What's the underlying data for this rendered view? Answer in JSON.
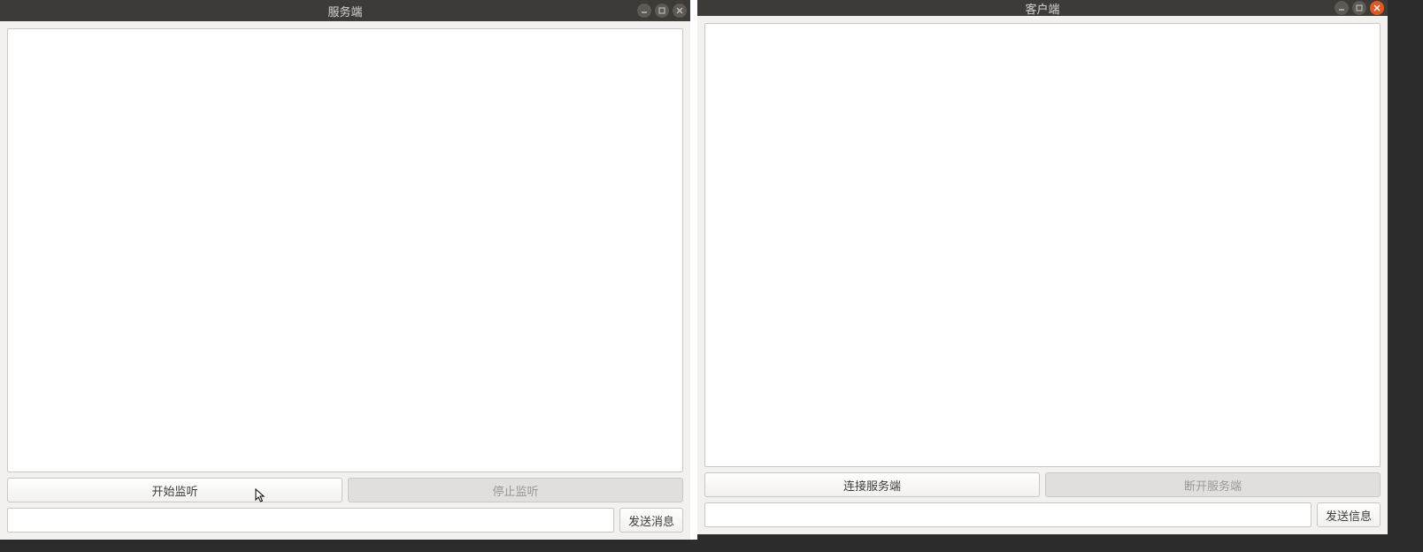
{
  "server": {
    "title": "服务端",
    "buttons": {
      "start_listen": "开始监听",
      "stop_listen": "停止监听",
      "send": "发送消息"
    },
    "message_input": "",
    "log": ""
  },
  "client": {
    "title": "客户端",
    "buttons": {
      "connect": "连接服务端",
      "disconnect": "断开服务端",
      "send": "发送信息"
    },
    "message_input": "",
    "log": ""
  },
  "titlebar_icons": {
    "minimize": "—",
    "maximize": "◻",
    "close": "✕"
  }
}
